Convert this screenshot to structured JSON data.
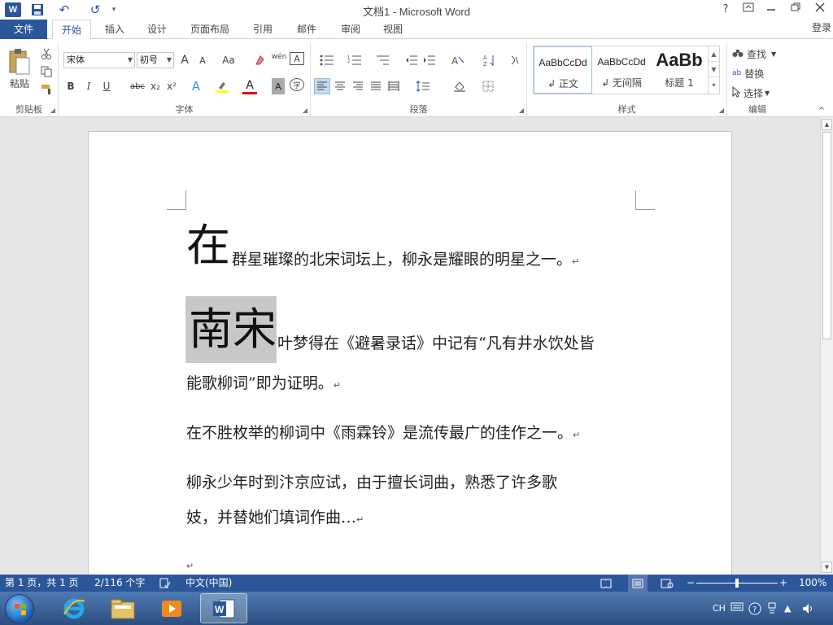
{
  "window": {
    "title": "文档1 - Microsoft Word",
    "help": "?",
    "login": "登录"
  },
  "qat": {
    "word_logo": "W",
    "undo": "↶",
    "redo": "↺",
    "more": "▾"
  },
  "tabs": {
    "file": "文件",
    "items": [
      "开始",
      "插入",
      "设计",
      "页面布局",
      "引用",
      "邮件",
      "审阅",
      "视图"
    ]
  },
  "ribbon": {
    "clipboard": {
      "label": "剪贴板",
      "paste": "粘贴"
    },
    "font": {
      "label": "字体",
      "font_name": "宋体",
      "font_size": "初号",
      "grow": "A",
      "shrink": "A",
      "change_case": "Aa",
      "pinyin": "wén",
      "bold": "B",
      "italic": "I",
      "underline": "U",
      "strike": "abc",
      "subscript": "x₂",
      "superscript": "x²",
      "text_effect": "A",
      "font_color": "A",
      "char_shading": "A",
      "enclose": "字"
    },
    "paragraph": {
      "label": "段落"
    },
    "styles": {
      "label": "样式",
      "items": [
        {
          "sample": "AaBbCcDd",
          "name": "↲ 正文"
        },
        {
          "sample": "AaBbCcDd",
          "name": "↲ 无间隔"
        },
        {
          "sample": "AaBb",
          "name": "标题 1"
        }
      ]
    },
    "editing": {
      "label": "编辑",
      "find": "查找",
      "replace": "替换",
      "select": "选择"
    }
  },
  "document": {
    "paragraphs": [
      {
        "dropcap": "在",
        "text": "群星璀璨的北宋词坛上，柳永是耀眼的明星之一。"
      },
      {
        "dropcap": "南宋",
        "line1": "叶梦得在《避暑录话》中记有“凡有井水饮处皆",
        "line2": "能歌柳词”即为证明。"
      },
      {
        "text": "在不胜枚举的柳词中《雨霖铃》是流传最广的佳作之一。"
      },
      {
        "line1": "柳永少年时到汴京应试，由于擅长词曲，熟悉了许多歌",
        "line2": "妓，并替她们填词作曲…"
      }
    ],
    "paragraph_mark": "↵"
  },
  "statusbar": {
    "page": "第 1 页，共 1 页",
    "words": "2/116 个字",
    "language": "中文(中国)",
    "zoom": "100%",
    "zoom_level": 0.5
  },
  "taskbar": {
    "tray_lang": "CH"
  }
}
